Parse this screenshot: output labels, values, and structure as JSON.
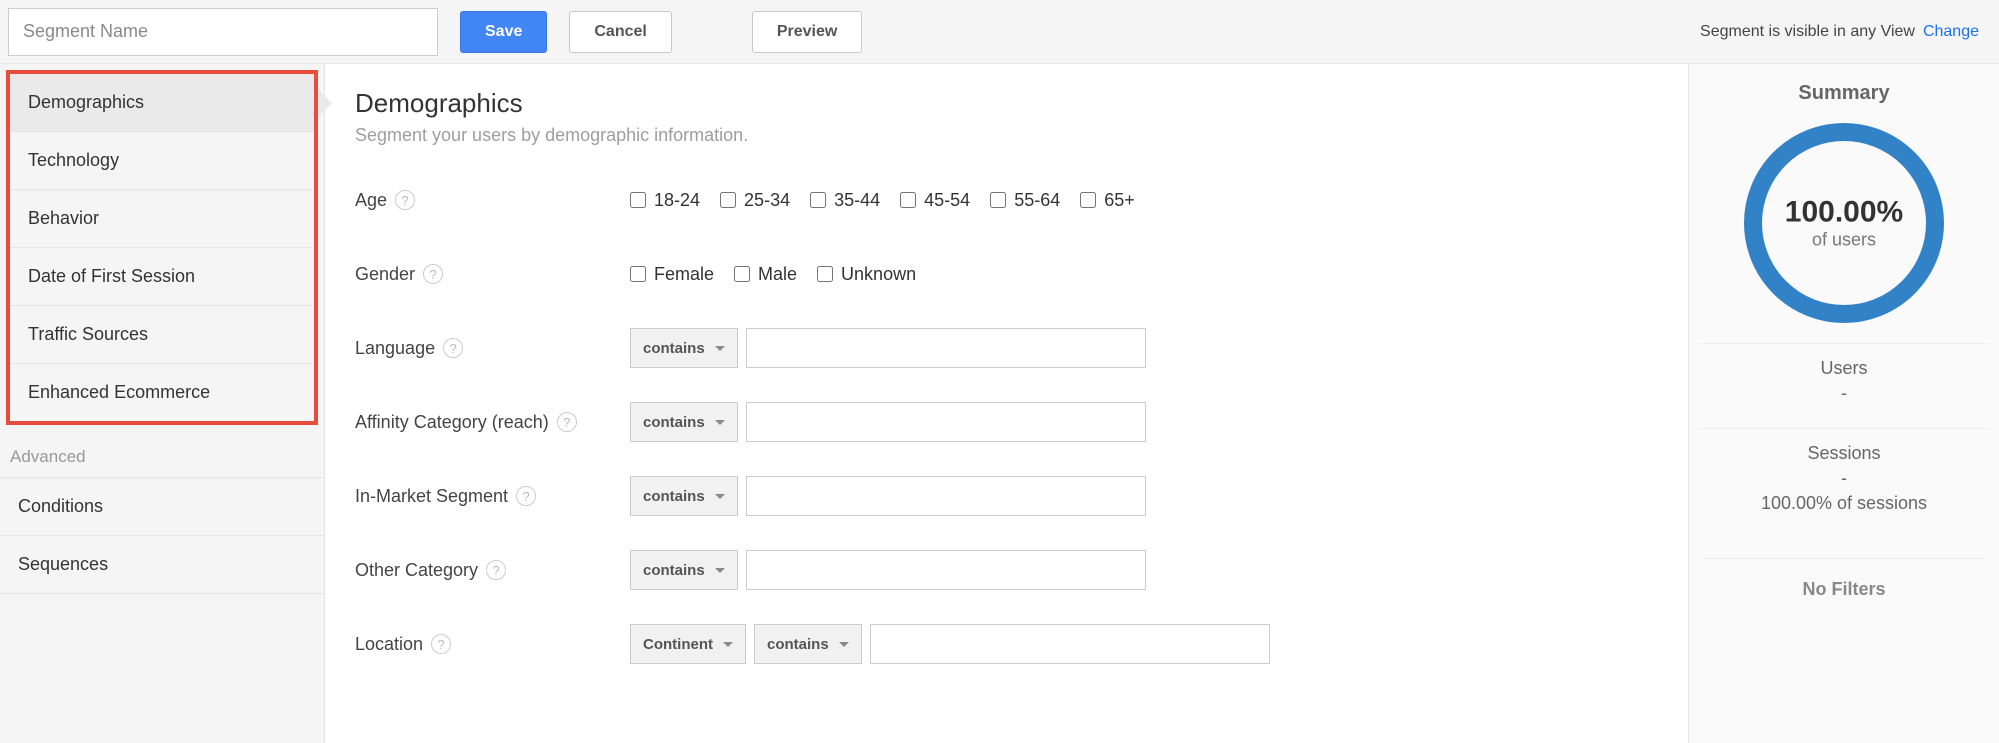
{
  "topbar": {
    "segment_name_placeholder": "Segment Name",
    "save_label": "Save",
    "cancel_label": "Cancel",
    "preview_label": "Preview",
    "visibility_text": "Segment is visible in any View",
    "change_link": "Change"
  },
  "sidebar": {
    "items": [
      {
        "label": "Demographics",
        "active": true
      },
      {
        "label": "Technology"
      },
      {
        "label": "Behavior"
      },
      {
        "label": "Date of First Session"
      },
      {
        "label": "Traffic Sources"
      },
      {
        "label": "Enhanced Ecommerce"
      }
    ],
    "advanced_label": "Advanced",
    "advanced_items": [
      {
        "label": "Conditions"
      },
      {
        "label": "Sequences"
      }
    ]
  },
  "main": {
    "title": "Demographics",
    "subtitle": "Segment your users by demographic information.",
    "age": {
      "label": "Age",
      "options": [
        "18-24",
        "25-34",
        "35-44",
        "45-54",
        "55-64",
        "65+"
      ]
    },
    "gender": {
      "label": "Gender",
      "options": [
        "Female",
        "Male",
        "Unknown"
      ]
    },
    "language": {
      "label": "Language",
      "operator": "contains"
    },
    "affinity": {
      "label": "Affinity Category (reach)",
      "operator": "contains"
    },
    "inmarket": {
      "label": "In-Market Segment",
      "operator": "contains"
    },
    "othercat": {
      "label": "Other Category",
      "operator": "contains"
    },
    "location": {
      "label": "Location",
      "dimension": "Continent",
      "operator": "contains"
    }
  },
  "summary": {
    "title": "Summary",
    "pct": "100.00%",
    "pct_sub": "of users",
    "users_label": "Users",
    "users_value": "-",
    "sessions_label": "Sessions",
    "sessions_value": "-",
    "sessions_pct": "100.00% of sessions",
    "no_filters": "No Filters"
  }
}
